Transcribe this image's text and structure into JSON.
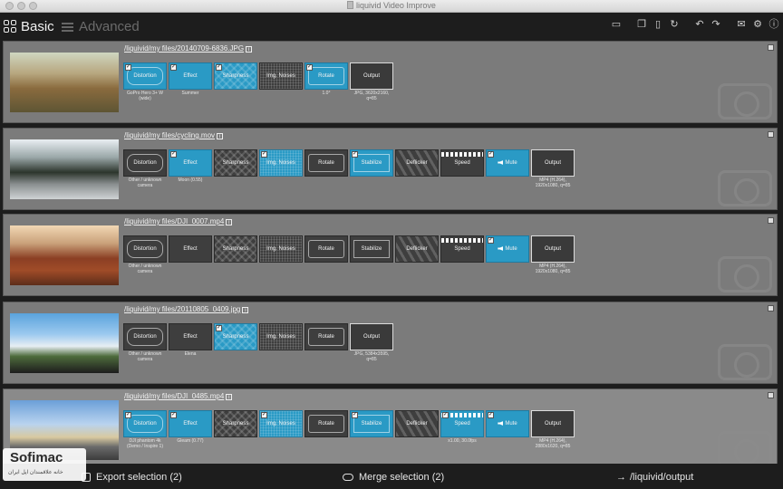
{
  "window": {
    "title": "liquivid Video Improve"
  },
  "toolbar": {
    "basic_label": "Basic",
    "advanced_label": "Advanced",
    "icons": [
      "folder-icon",
      "copy-icon",
      "paste-icon",
      "refresh-icon",
      "undo-icon",
      "redo-icon",
      "mail-icon",
      "gear-icon",
      "info-icon"
    ]
  },
  "rows": [
    {
      "path": "/liquivid/my files/20140709-6836.JPG",
      "tiles": [
        {
          "label": "Distortion",
          "on": true,
          "sub": "GoPro Hero 3+ W\n(wide)"
        },
        {
          "label": "Effect",
          "on": true,
          "sub": "Summer"
        },
        {
          "label": "Sharpness",
          "on": true,
          "sub": ""
        },
        {
          "label": "Img. Noises",
          "on": false,
          "sub": ""
        },
        {
          "label": "Rotate",
          "on": true,
          "sub": "1.0°"
        },
        {
          "label": "Output",
          "on": false,
          "sub": "JPG, 3620x2160,\nq=85"
        }
      ]
    },
    {
      "path": "/liquivid/my files/cycling.mov",
      "tiles": [
        {
          "label": "Distortion",
          "on": false,
          "sub": "Other / unknown\ncamera"
        },
        {
          "label": "Effect",
          "on": true,
          "sub": "Moon (0.55)"
        },
        {
          "label": "Sharpness",
          "on": false,
          "sub": ""
        },
        {
          "label": "Img. Noises",
          "on": true,
          "sub": ""
        },
        {
          "label": "Rotate",
          "on": false,
          "sub": ""
        },
        {
          "label": "Stabilize",
          "on": true,
          "sub": ""
        },
        {
          "label": "Deflicker",
          "on": false,
          "sub": ""
        },
        {
          "label": "Speed",
          "on": false,
          "sub": ""
        },
        {
          "label": "Mute",
          "on": true,
          "sub": ""
        },
        {
          "label": "Output",
          "on": false,
          "sub": "MP4 (H.264),\n1920x1080, q=85"
        }
      ]
    },
    {
      "path": "/liquivid/my files/DJI_0007.mp4",
      "tiles": [
        {
          "label": "Distortion",
          "on": false,
          "sub": "Other / unknown\ncamera"
        },
        {
          "label": "Effect",
          "on": false,
          "sub": ""
        },
        {
          "label": "Sharpness",
          "on": false,
          "sub": ""
        },
        {
          "label": "Img. Noises",
          "on": false,
          "sub": ""
        },
        {
          "label": "Rotate",
          "on": false,
          "sub": ""
        },
        {
          "label": "Stabilize",
          "on": false,
          "sub": ""
        },
        {
          "label": "Deflicker",
          "on": false,
          "sub": ""
        },
        {
          "label": "Speed",
          "on": false,
          "sub": ""
        },
        {
          "label": "Mute",
          "on": true,
          "sub": ""
        },
        {
          "label": "Output",
          "on": false,
          "sub": "MP4 (H.264),\n1920x1080, q=85"
        }
      ]
    },
    {
      "path": "/liquivid/my files/20110805_0409.jpg",
      "tiles": [
        {
          "label": "Distortion",
          "on": false,
          "sub": "Other / unknown\ncamera"
        },
        {
          "label": "Effect",
          "on": false,
          "sub": "Elena"
        },
        {
          "label": "Sharpness",
          "on": true,
          "sub": ""
        },
        {
          "label": "Img. Noises",
          "on": false,
          "sub": ""
        },
        {
          "label": "Rotate",
          "on": false,
          "sub": ""
        },
        {
          "label": "Output",
          "on": false,
          "sub": "JPG, 5384x3595,\nq=85"
        }
      ]
    },
    {
      "path": "/liquivid/my files/DJI_0485.mp4",
      "tiles": [
        {
          "label": "Distortion",
          "on": true,
          "sub": "DJI phantom 4k\n(Demo / Inspire 1)"
        },
        {
          "label": "Effect",
          "on": true,
          "sub": "Gleam (0.77)"
        },
        {
          "label": "Sharpness",
          "on": false,
          "sub": ""
        },
        {
          "label": "Img. Noises",
          "on": true,
          "sub": ""
        },
        {
          "label": "Rotate",
          "on": false,
          "sub": ""
        },
        {
          "label": "Stabilize",
          "on": true,
          "sub": ""
        },
        {
          "label": "Deflicker",
          "on": false,
          "sub": ""
        },
        {
          "label": "Speed",
          "on": true,
          "sub": "x1.00, 30.0fps"
        },
        {
          "label": "Mute",
          "on": true,
          "sub": ""
        },
        {
          "label": "Output",
          "on": false,
          "sub": "MP4 (H.264),\n2880x1620, q=85"
        }
      ]
    }
  ],
  "bottom": {
    "export_label": "Export selection (2)",
    "merge_label": "Merge selection (2)",
    "output_label": "/liquivid/output"
  },
  "watermark": {
    "title": "Sofimac",
    "subtitle": "خانه علاقمندان اپل ایران"
  }
}
